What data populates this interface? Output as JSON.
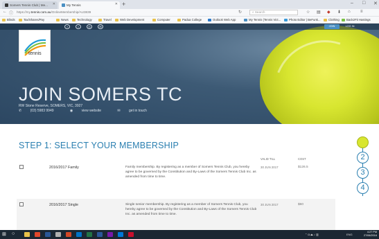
{
  "browser": {
    "tabs": [
      {
        "label": "Somers Tennis Club | Me..."
      },
      {
        "label": "My Tennis"
      }
    ],
    "new_tab": "+",
    "window_controls": {
      "minimize": "–",
      "maximize": "□",
      "close": "✕"
    },
    "url_prefix": "https://my.",
    "url_domain": "tennis.com.au",
    "url_path": "/OnlineMembership/AU3839",
    "search_placeholder": "Search",
    "bookmarks": [
      "Blinds",
      "Tax/Shares/Pay",
      "News",
      "Technology",
      "Travel",
      "Web Development",
      "Computer",
      "Padua College",
      "Outlook Web App",
      "My Tennis (Tennis Vict...",
      "Photo Editor | BeFunk...",
      "Clothing",
      "Back2Fit Hastings"
    ]
  },
  "hero": {
    "social_icons": [
      "facebook-icon",
      "twitter-icon",
      "instagram-icon",
      "email-icon"
    ],
    "join_button": "JOIN",
    "login_button": "LOG IN",
    "logo_text": "tennis",
    "title": "JOIN SOMERS TC",
    "address": "RW Stone Reserve, SOMERS, VIC, 3927",
    "phone": "(03) 5983 9949",
    "website_link": "view website",
    "contact_link": "get in touch"
  },
  "membership": {
    "step_title": "STEP 1: SELECT YOUR MEMBERSHIP",
    "columns": {
      "valid_till": "VALID TILL",
      "cost": "COST"
    },
    "rows": [
      {
        "name": "2016/2017 Family",
        "description": "Family membership. By registering as a member of Somers Tennis Club, you hereby agree to be governed by the Constitution and By-Laws of the Somers Tennis Club Inc. as amended from time to time.",
        "valid_till": "30 JUN 2017",
        "cost": "$126.5"
      },
      {
        "name": "2016/2017 Single",
        "description": "Single senior membership. By registering as a member of Somers Tennis Club, you hereby agree to be governed by the Constitution and By-Laws of the Somers Tennis Club Inc. as amended from time to time.",
        "valid_till": "30 JUN 2017",
        "cost": "$60"
      }
    ]
  },
  "stepper": {
    "steps": [
      "",
      "2",
      "3",
      "4"
    ],
    "current_step_icon": "tennis-ball-icon"
  },
  "taskbar": {
    "lang": "ENG",
    "time": "4:27 PM",
    "date": "27/06/2016"
  },
  "colors": {
    "accent": "#2a7fb0",
    "ball": "#d8e630",
    "hero": "#3d5a75",
    "taskbar": "#1b2733"
  }
}
